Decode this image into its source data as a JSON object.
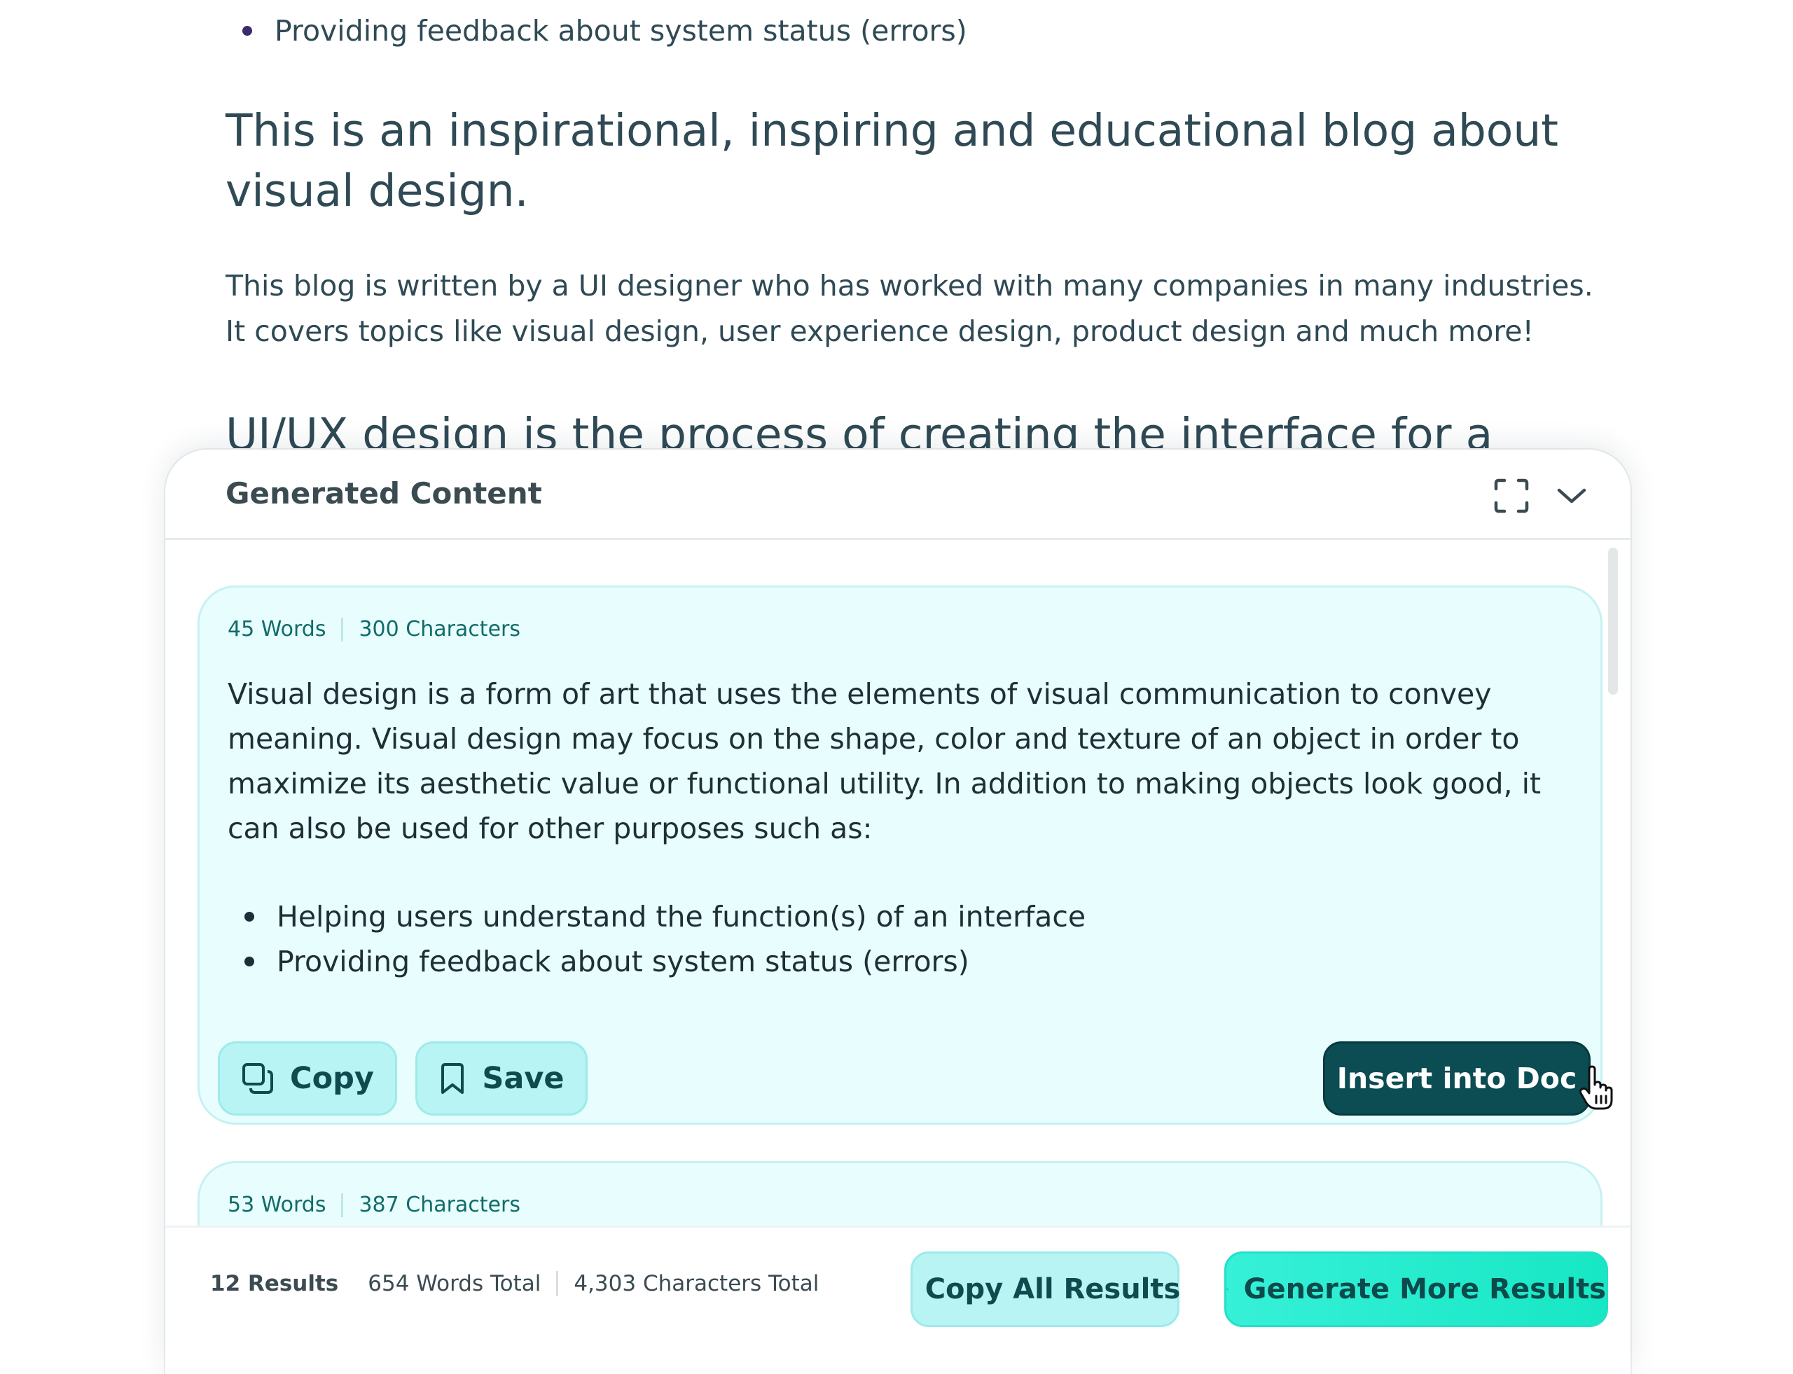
{
  "document": {
    "bullet_top": "Providing feedback about system status (errors)",
    "heading": "This is an inspirational, inspiring and educational blog about visual design.",
    "paragraph": "This blog is written by a UI designer who has worked with many companies in many industries. It covers topics like visual design, user experience design, product design and much more!",
    "heading_2": "UI/UX design is the process of creating the interface for a"
  },
  "panel": {
    "title": "Generated Content",
    "expand_icon": "expand-icon",
    "collapse_icon": "chevron-down-icon",
    "results": [
      {
        "words": "45 Words",
        "characters": "300 Characters",
        "text": "Visual design is a form of art that uses the elements of visual communication to convey meaning. Visual design may focus on the shape, color and texture of an object in order to maximize its aesthetic value or functional utility. In addition to making objects look good, it can also be used for other purposes such as:",
        "bullets": [
          "Helping users understand the function(s) of an interface",
          "Providing feedback about system status (errors)"
        ],
        "copy_label": "Copy",
        "save_label": "Save",
        "insert_label": "Insert into Doc"
      },
      {
        "words": "53 Words",
        "characters": "387 Characters"
      }
    ],
    "footer": {
      "results_count": "12 Results",
      "words_total": "654 Words Total",
      "characters_total": "4,303 Characters Total",
      "copy_all_label": "Copy All Results",
      "generate_more_label": "Generate More Results"
    }
  },
  "colors": {
    "card_bg": "#e8fdfd",
    "accent_dark": "#0b4d52",
    "accent_teal": "#17e7c4",
    "stats_text": "#116c6a"
  }
}
